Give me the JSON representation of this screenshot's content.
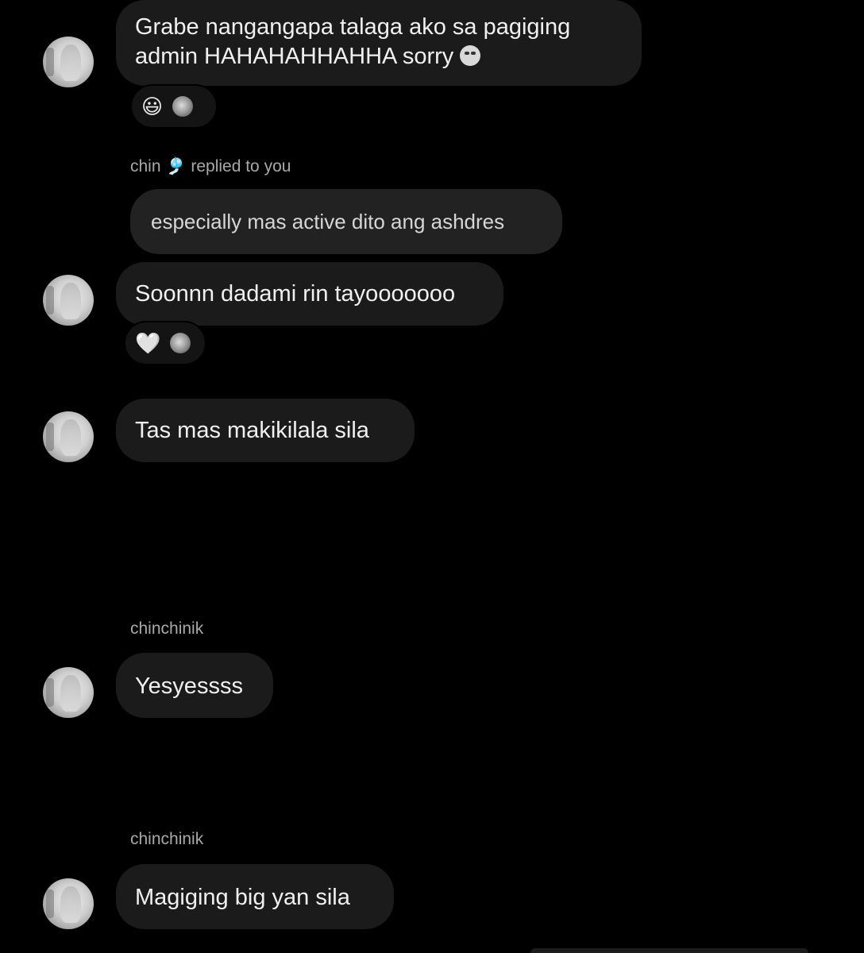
{
  "messages": [
    {
      "text_line1": "Grabe nangangapa talaga ako sa pagiging",
      "text_line2": "admin HAHAHAHHAHHA sorry",
      "trailing_emoji": "crying-face-icon",
      "reactions": [
        "😃"
      ]
    },
    {
      "reply_meta": "chin 🎐 replied to you",
      "reply_quote": "especially mas active dito ang ashdres",
      "text": "Soonnn dadami rin tayooooooo",
      "reactions": [
        "🤍"
      ]
    },
    {
      "text": "Tas mas makikilala sila"
    },
    {
      "sender": "chinchinik",
      "text": "Yesyessss"
    },
    {
      "sender": "chinchinik",
      "text": "Magiging big yan sila"
    }
  ],
  "colors": {
    "background": "#000000",
    "bubble": "#1b1b1b",
    "reply_bubble": "#222222",
    "meta_text": "#a8a8a8"
  }
}
